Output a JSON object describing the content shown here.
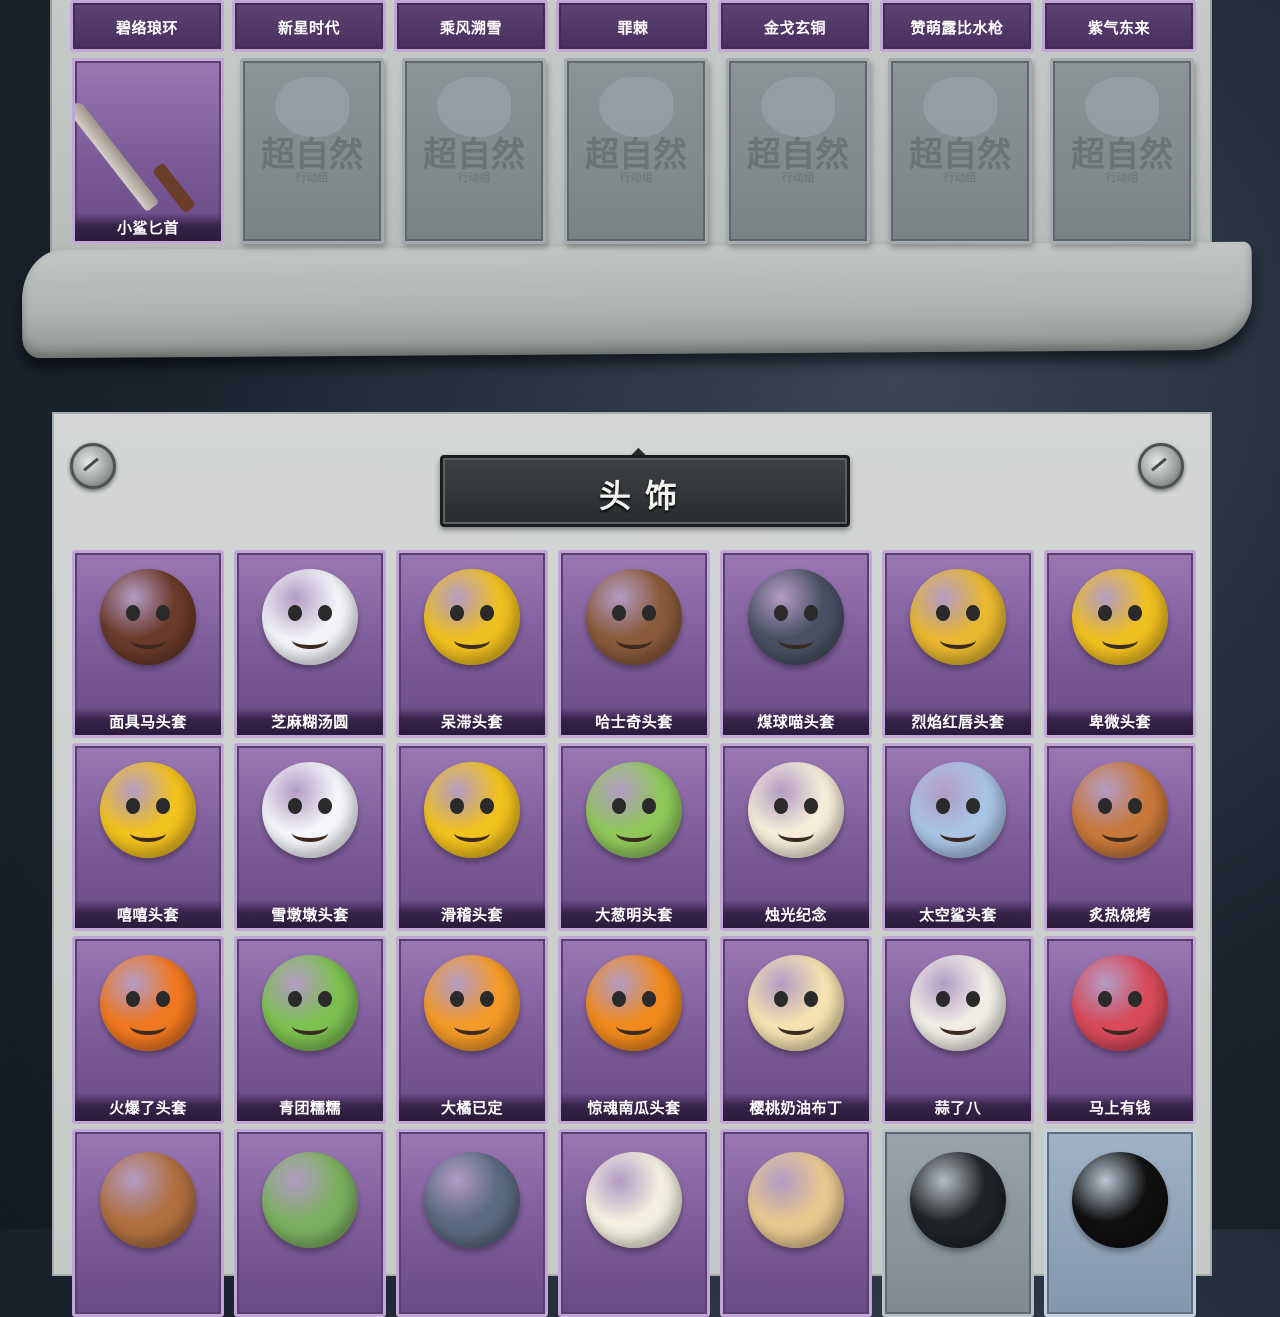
{
  "weapons": {
    "strip_items": [
      {
        "name": "碧络琅环"
      },
      {
        "name": "新星时代"
      },
      {
        "name": "乘风溯雪"
      },
      {
        "name": "罪棘"
      },
      {
        "name": "金戈玄铜"
      },
      {
        "name": "赞萌露比水枪"
      },
      {
        "name": "紫气东来"
      }
    ],
    "featured": {
      "name": "小鲨匕首"
    },
    "locked_watermark": "超自然",
    "locked_watermark_sub": "行动组",
    "locked_count": 6
  },
  "headwear": {
    "title": "头饰",
    "items": [
      {
        "name": "面具马头套",
        "color": "#6b3a2a",
        "icon": "horse-mask-icon"
      },
      {
        "name": "芝麻糊汤圆",
        "color": "#f2f4f8",
        "icon": "rice-ball-icon"
      },
      {
        "name": "呆滞头套",
        "color": "#f0c020",
        "icon": "dazed-emoji-icon"
      },
      {
        "name": "哈士奇头套",
        "color": "#8a5a3a",
        "icon": "husky-icon"
      },
      {
        "name": "煤球喵头套",
        "color": "#4a5064",
        "icon": "cat-icon"
      },
      {
        "name": "烈焰红唇头套",
        "color": "#e8b830",
        "icon": "yellow-mask-icon"
      },
      {
        "name": "卑微头套",
        "color": "#f0c020",
        "icon": "humble-emoji-icon"
      },
      {
        "name": "嘻嘻头套",
        "color": "#f2c21e",
        "icon": "grin-emoji-icon"
      },
      {
        "name": "雪墩墩头套",
        "color": "#f4f6fa",
        "icon": "snowman-icon"
      },
      {
        "name": "滑稽头套",
        "color": "#f2c21e",
        "icon": "funny-emoji-icon"
      },
      {
        "name": "大葱明头套",
        "color": "#8fc75a",
        "icon": "leek-icon"
      },
      {
        "name": "烛光纪念",
        "color": "#f6ecd8",
        "icon": "candle-icon"
      },
      {
        "name": "太空鲨头套",
        "color": "#a9c4e4",
        "icon": "shark-icon"
      },
      {
        "name": "炙热烧烤",
        "color": "#c8783a",
        "icon": "bbq-icon"
      },
      {
        "name": "火爆了头套",
        "color": "#f07820",
        "icon": "fire-icon"
      },
      {
        "name": "青团糯糯",
        "color": "#7cc050",
        "icon": "qingtuan-icon"
      },
      {
        "name": "大橘已定",
        "color": "#f49a28",
        "icon": "orange-icon"
      },
      {
        "name": "惊魂南瓜头套",
        "color": "#f08a1c",
        "icon": "pumpkin-icon"
      },
      {
        "name": "樱桃奶油布丁",
        "color": "#f6e2b0",
        "icon": "pudding-icon"
      },
      {
        "name": "蒜了八",
        "color": "#f0ede6",
        "icon": "garlic-icon"
      },
      {
        "name": "马上有钱",
        "color": "#d84a5a",
        "icon": "red-horse-icon"
      }
    ],
    "partial_row": [
      {
        "color": "#b07040",
        "icon": "beaver-icon",
        "tint": "purple"
      },
      {
        "color": "#7cb060",
        "icon": "frog-icon",
        "tint": "purple"
      },
      {
        "color": "#5a6a80",
        "icon": "bird-icon",
        "tint": "purple"
      },
      {
        "color": "#f4f0e0",
        "icon": "skull-crown-icon",
        "tint": "purple"
      },
      {
        "color": "#e8c890",
        "icon": "hamster-icon",
        "tint": "purple"
      },
      {
        "color": "#202428",
        "icon": "helmet-icon",
        "tint": "gray"
      },
      {
        "color": "#101010",
        "icon": "pixel-glasses-icon",
        "tint": "blue"
      }
    ]
  }
}
